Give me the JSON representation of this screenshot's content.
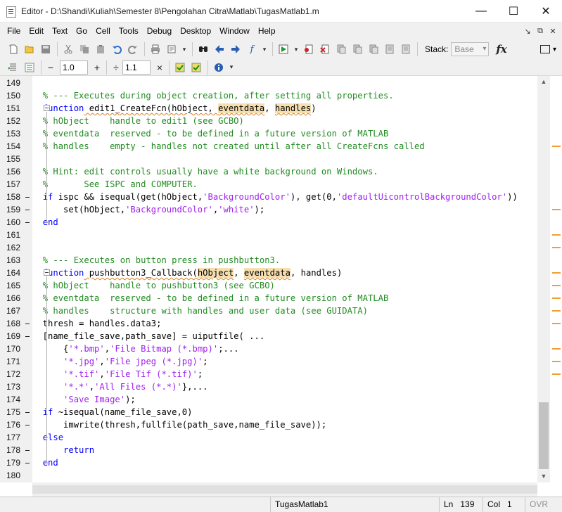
{
  "window": {
    "title": "Editor - D:\\Shandi\\Kuliah\\Semester 8\\Pengolahan Citra\\Matlab\\TugasMatlab1.m",
    "minimize_glyph": "—",
    "maximize_glyph": "☐",
    "close_glyph": "✕"
  },
  "menu": {
    "items": [
      "File",
      "Edit",
      "Text",
      "Go",
      "Cell",
      "Tools",
      "Debug",
      "Desktop",
      "Window",
      "Help"
    ],
    "right_glyphs": [
      "↘",
      "⧉",
      "✕"
    ]
  },
  "toolbar": {
    "icons": [
      "new-file-icon",
      "open-folder-icon",
      "save-icon",
      "cut-icon",
      "copy-icon",
      "paste-icon",
      "undo-icon",
      "redo-icon",
      "print-icon",
      "find-icon",
      "back-icon",
      "forward-icon",
      "function-browser-icon",
      "run-icon",
      "set-breakpoint-icon",
      "clear-breakpoint-icon",
      "step-icon",
      "step-in-icon",
      "step-out-icon",
      "continue-icon",
      "exit-debug-icon"
    ],
    "stack_label": "Stack:",
    "stack_value": "Base",
    "fx_label": "fx"
  },
  "cell_toolbar": {
    "minus_glyph": "−",
    "plus_glyph": "+",
    "divide_glyph": "÷",
    "times_glyph": "×",
    "value1": "1.0",
    "value2": "1.1"
  },
  "status": {
    "file_name": "TugasMatlab1",
    "ln_label": "Ln",
    "ln_value": "139",
    "col_label": "Col",
    "col_value": "1",
    "ovr": "OVR"
  },
  "editor": {
    "lines": [
      {
        "n": "149",
        "dash": false,
        "segs": []
      },
      {
        "n": "150",
        "dash": false,
        "segs": [
          {
            "t": "  ",
            "c": "txt"
          },
          {
            "t": "% --- Executes during object creation, after setting all properties.",
            "c": "com"
          }
        ]
      },
      {
        "n": "151",
        "dash": false,
        "segs": [
          {
            "t": "  ",
            "c": "txt"
          },
          {
            "t": "function",
            "c": "kw"
          },
          {
            "t": " edit1_CreateFcn(hObject, ",
            "c": "txt",
            "sq": true
          },
          {
            "t": "eventdata",
            "c": "txt",
            "hl": true,
            "sq": true
          },
          {
            "t": ", ",
            "c": "txt"
          },
          {
            "t": "handles",
            "c": "txt",
            "hl": true,
            "sq": true
          },
          {
            "t": ")",
            "c": "txt"
          }
        ]
      },
      {
        "n": "152",
        "dash": false,
        "segs": [
          {
            "t": "  ",
            "c": "txt"
          },
          {
            "t": "% hObject    handle to edit1 (see GCBO)",
            "c": "com"
          }
        ]
      },
      {
        "n": "153",
        "dash": false,
        "segs": [
          {
            "t": "  ",
            "c": "txt"
          },
          {
            "t": "% eventdata  reserved - to be defined in a future version of MATLAB",
            "c": "com"
          }
        ]
      },
      {
        "n": "154",
        "dash": false,
        "segs": [
          {
            "t": "  ",
            "c": "txt"
          },
          {
            "t": "% handles    empty - handles not created until after all CreateFcns called",
            "c": "com"
          }
        ]
      },
      {
        "n": "155",
        "dash": false,
        "segs": []
      },
      {
        "n": "156",
        "dash": false,
        "segs": [
          {
            "t": "  ",
            "c": "txt"
          },
          {
            "t": "% Hint: edit controls usually have a white background on Windows.",
            "c": "com"
          }
        ]
      },
      {
        "n": "157",
        "dash": false,
        "segs": [
          {
            "t": "  ",
            "c": "txt"
          },
          {
            "t": "%       See ISPC and COMPUTER.",
            "c": "com"
          }
        ]
      },
      {
        "n": "158",
        "dash": true,
        "segs": [
          {
            "t": "  ",
            "c": "txt"
          },
          {
            "t": "if",
            "c": "kw"
          },
          {
            "t": " ispc && isequal(get(hObject,",
            "c": "txt"
          },
          {
            "t": "'BackgroundColor'",
            "c": "str"
          },
          {
            "t": "), get(0,",
            "c": "txt"
          },
          {
            "t": "'defaultUicontrolBackgroundColor'",
            "c": "str"
          },
          {
            "t": "))",
            "c": "txt"
          }
        ]
      },
      {
        "n": "159",
        "dash": true,
        "segs": [
          {
            "t": "      set(hObject,",
            "c": "txt"
          },
          {
            "t": "'BackgroundColor'",
            "c": "str"
          },
          {
            "t": ",",
            "c": "txt"
          },
          {
            "t": "'white'",
            "c": "str"
          },
          {
            "t": ");",
            "c": "txt"
          }
        ]
      },
      {
        "n": "160",
        "dash": true,
        "segs": [
          {
            "t": "  ",
            "c": "txt"
          },
          {
            "t": "end",
            "c": "kw"
          }
        ]
      },
      {
        "n": "161",
        "dash": false,
        "segs": []
      },
      {
        "n": "162",
        "dash": false,
        "segs": []
      },
      {
        "n": "163",
        "dash": false,
        "segs": [
          {
            "t": "  ",
            "c": "txt"
          },
          {
            "t": "% --- Executes on button press in pushbutton3.",
            "c": "com"
          }
        ]
      },
      {
        "n": "164",
        "dash": false,
        "segs": [
          {
            "t": "  ",
            "c": "txt"
          },
          {
            "t": "function",
            "c": "kw"
          },
          {
            "t": " pushbutton3_Callback(",
            "c": "txt",
            "sq": true
          },
          {
            "t": "hObject",
            "c": "txt",
            "hl": true,
            "sq": true
          },
          {
            "t": ", ",
            "c": "txt"
          },
          {
            "t": "eventdata",
            "c": "txt",
            "hl": true,
            "sq": true
          },
          {
            "t": ", handles)",
            "c": "txt"
          }
        ]
      },
      {
        "n": "165",
        "dash": false,
        "segs": [
          {
            "t": "  ",
            "c": "txt"
          },
          {
            "t": "% hObject    handle to pushbutton3 (see GCBO)",
            "c": "com"
          }
        ]
      },
      {
        "n": "166",
        "dash": false,
        "segs": [
          {
            "t": "  ",
            "c": "txt"
          },
          {
            "t": "% eventdata  reserved - to be defined in a future version of MATLAB",
            "c": "com"
          }
        ]
      },
      {
        "n": "167",
        "dash": false,
        "segs": [
          {
            "t": "  ",
            "c": "txt"
          },
          {
            "t": "% handles    structure with handles and user data (see GUIDATA)",
            "c": "com"
          }
        ]
      },
      {
        "n": "168",
        "dash": true,
        "segs": [
          {
            "t": "  thresh = handles.data3;",
            "c": "txt"
          }
        ]
      },
      {
        "n": "169",
        "dash": true,
        "segs": [
          {
            "t": "  [name_file_save,path_save] = uiputfile( ...",
            "c": "txt"
          }
        ]
      },
      {
        "n": "170",
        "dash": false,
        "segs": [
          {
            "t": "      {",
            "c": "txt"
          },
          {
            "t": "'*.bmp'",
            "c": "str"
          },
          {
            "t": ",",
            "c": "txt"
          },
          {
            "t": "'File Bitmap (*.bmp)'",
            "c": "str"
          },
          {
            "t": ";...",
            "c": "txt"
          }
        ]
      },
      {
        "n": "171",
        "dash": false,
        "segs": [
          {
            "t": "      ",
            "c": "txt"
          },
          {
            "t": "'*.jpg'",
            "c": "str"
          },
          {
            "t": ",",
            "c": "txt"
          },
          {
            "t": "'File jpeg (*.jpg)'",
            "c": "str"
          },
          {
            "t": ";",
            "c": "txt"
          }
        ]
      },
      {
        "n": "172",
        "dash": false,
        "segs": [
          {
            "t": "      ",
            "c": "txt"
          },
          {
            "t": "'*.tif'",
            "c": "str"
          },
          {
            "t": ",",
            "c": "txt"
          },
          {
            "t": "'File Tif (*.tif)'",
            "c": "str"
          },
          {
            "t": ";",
            "c": "txt"
          }
        ]
      },
      {
        "n": "173",
        "dash": false,
        "segs": [
          {
            "t": "      ",
            "c": "txt"
          },
          {
            "t": "'*.*'",
            "c": "str"
          },
          {
            "t": ",",
            "c": "txt"
          },
          {
            "t": "'All Files (*.*)'",
            "c": "str"
          },
          {
            "t": "},...",
            "c": "txt"
          }
        ]
      },
      {
        "n": "174",
        "dash": false,
        "segs": [
          {
            "t": "      ",
            "c": "txt"
          },
          {
            "t": "'Save Image'",
            "c": "str"
          },
          {
            "t": ");",
            "c": "txt"
          }
        ]
      },
      {
        "n": "175",
        "dash": true,
        "segs": [
          {
            "t": "  ",
            "c": "txt"
          },
          {
            "t": "if",
            "c": "kw"
          },
          {
            "t": " ~isequal(name_file_save,0)",
            "c": "txt"
          }
        ]
      },
      {
        "n": "176",
        "dash": true,
        "segs": [
          {
            "t": "      imwrite(thresh,fullfile(path_save,name_file_save));",
            "c": "txt"
          }
        ]
      },
      {
        "n": "177",
        "dash": false,
        "segs": [
          {
            "t": "  ",
            "c": "txt"
          },
          {
            "t": "else",
            "c": "kw"
          }
        ]
      },
      {
        "n": "178",
        "dash": true,
        "segs": [
          {
            "t": "      ",
            "c": "txt"
          },
          {
            "t": "return",
            "c": "kw"
          }
        ]
      },
      {
        "n": "179",
        "dash": true,
        "segs": [
          {
            "t": "  ",
            "c": "txt"
          },
          {
            "t": "end",
            "c": "kw"
          }
        ]
      },
      {
        "n": "180",
        "dash": false,
        "segs": []
      }
    ],
    "folds": [
      {
        "start": 151,
        "end": 160
      },
      {
        "start": 164,
        "end": 179
      }
    ],
    "marker_rows": [
      5,
      10,
      12,
      13,
      15,
      16,
      17,
      18,
      19,
      21,
      22,
      23
    ]
  }
}
